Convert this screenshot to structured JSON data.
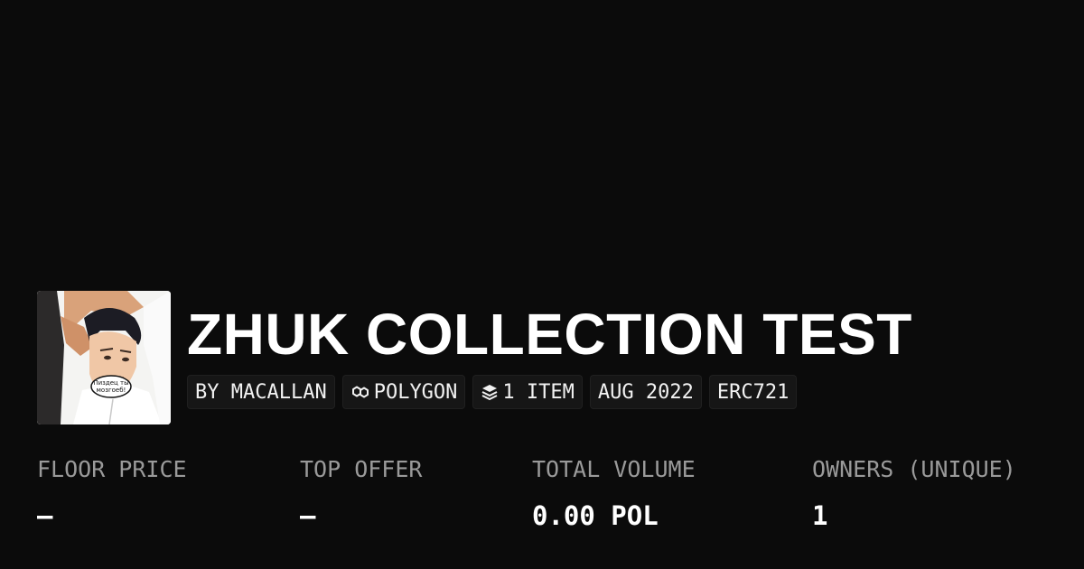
{
  "collection": {
    "title": "ZHUK COLLECTION TEST",
    "avatar_icon": "collection-avatar-image",
    "speech_bubble_text": "Пиздец ты мозгоеб!"
  },
  "chips": {
    "creator": "BY MACALLAN",
    "chain": "POLYGON",
    "chain_icon": "polygon-chain-icon",
    "items": "1 ITEM",
    "items_icon": "layers-icon",
    "date": "AUG 2022",
    "standard": "ERC721"
  },
  "stats": {
    "floor_price": {
      "label": "FLOOR PRICE",
      "value": "–"
    },
    "top_offer": {
      "label": "TOP OFFER",
      "value": "–"
    },
    "total_volume": {
      "label": "TOTAL VOLUME",
      "value": "0.00 POL"
    },
    "owners": {
      "label": "OWNERS (UNIQUE)",
      "value": "1"
    }
  },
  "colors": {
    "background": "#0b0b0b",
    "text": "#ffffff",
    "muted_label": "#9a9a9a",
    "chip_background": "#161616"
  }
}
